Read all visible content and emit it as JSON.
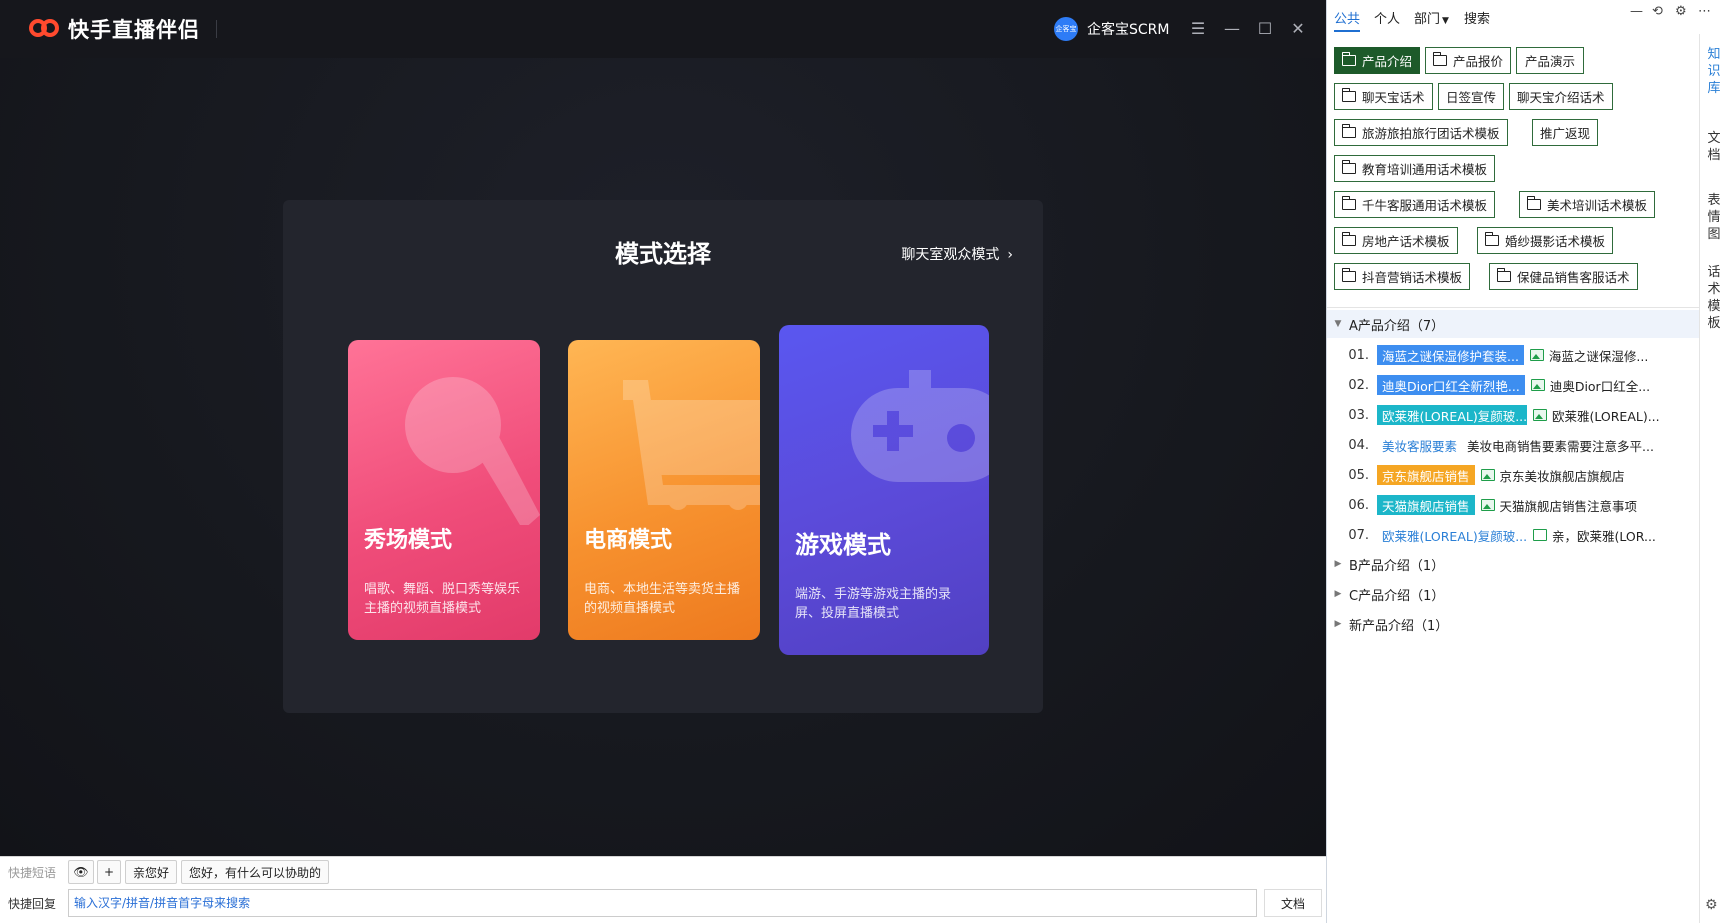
{
  "app": {
    "title": "快手直播伴侣",
    "user": {
      "avatar_text": "企客宝",
      "name": "企客宝SCRM"
    },
    "window_controls": [
      "menu-icon",
      "minimize-icon",
      "maximize-icon",
      "close-icon"
    ],
    "mode_panel": {
      "title": "模式选择",
      "audience_link": "聊天室观众模式",
      "cards": [
        {
          "name": "秀场模式",
          "desc_line1": "唱歌、舞蹈、脱口秀等娱乐",
          "desc_line2": "主播的视频直播模式",
          "icon": "lollipop-microphone-icon",
          "color": "#f04d7a"
        },
        {
          "name": "电商模式",
          "desc_line1": "电商、本地生活等卖货主播",
          "desc_line2": "的视频直播模式",
          "icon": "shopping-cart-icon",
          "color": "#f7922f"
        },
        {
          "name": "游戏模式",
          "desc_line1": "端游、手游等游戏主播的录",
          "desc_line2": "屏、投屏直播模式",
          "icon": "gamepad-icon",
          "color": "#5b4ad8"
        }
      ]
    }
  },
  "quick_bar": {
    "phrase_label": "快捷短语",
    "phrases": [
      "亲您好",
      "您好，有什么可以协助的"
    ],
    "reply_label": "快捷回复",
    "input_placeholder": "输入汉字/拼音/拼音首字母来搜索",
    "doc_button": "文档"
  },
  "side": {
    "tabs": [
      "公共",
      "个人",
      "部门",
      "搜索"
    ],
    "active_tab": "公共",
    "folders": [
      "产品介绍",
      "产品报价",
      "产品演示",
      "聊天宝话术",
      "日签宣传",
      "聊天宝介绍话术",
      "旅游旅拍旅行团话术模板",
      "推广返现",
      "教育培训通用话术模板",
      "千牛客服通用话术模板",
      "美术培训话术模板",
      "房地产话术模板",
      "婚纱摄影话术模板",
      "抖音营销话术模板",
      "保健品销售客服话术"
    ],
    "selected_folder": "产品介绍",
    "tree": {
      "open_group": {
        "label": "A产品介绍（7）"
      },
      "rows": [
        {
          "num": "01.",
          "tag": "海蓝之谜保湿修护套装...",
          "tag_color": "#3d8ef0",
          "icon": "image-icon",
          "text": "海蓝之谜保湿修..."
        },
        {
          "num": "02.",
          "tag": "迪奥Dior口红全新烈艳...",
          "tag_color": "#3d8ef0",
          "icon": "image-icon",
          "text": "迪奥Dior口红全..."
        },
        {
          "num": "03.",
          "tag": "欧莱雅(LOREAL)复颜玻...",
          "tag_color": "#1cb6c9",
          "icon": "image-icon",
          "text": "欧莱雅(LOREAL)..."
        },
        {
          "num": "04.",
          "tag": "美妆客服要素",
          "tag_color": "",
          "icon": "",
          "text": "美妆电商销售要素需要注意多平..."
        },
        {
          "num": "05.",
          "tag": "京东旗舰店销售",
          "tag_color": "#f5a623",
          "icon": "image-icon",
          "text": "京东美妆旗舰店旗舰店"
        },
        {
          "num": "06.",
          "tag": "天猫旗舰店销售",
          "tag_color": "#1cb6c9",
          "icon": "image-icon",
          "text": "天猫旗舰店销售注意事项"
        },
        {
          "num": "07.",
          "tag": "欧莱雅(LOREAL)复颜玻...",
          "tag_color": "",
          "icon": "folder-icon",
          "text": "亲，欧莱雅(LOR..."
        }
      ],
      "closed_groups": [
        "B产品介绍（1）",
        "C产品介绍（1）",
        "新产品介绍（1）"
      ]
    },
    "vnav": [
      "知识库",
      "文档",
      "表情图",
      "话术模板"
    ],
    "active_vnav": "知识库"
  }
}
